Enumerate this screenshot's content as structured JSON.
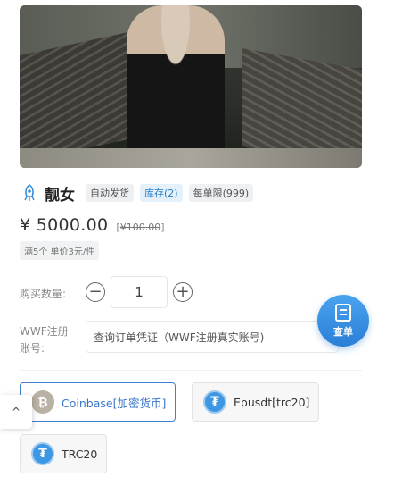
{
  "product": {
    "title": "靓女",
    "tags": [
      "自动发货",
      "库存(2)",
      "每单限(999)"
    ],
    "price": "¥ 5000.00",
    "original_price_bracket_open": "[",
    "original_price": "¥100.00",
    "original_price_bracket_close": "]",
    "promo": "满5个 单价3元/件"
  },
  "quantity": {
    "label": "购买数量:",
    "value": "1",
    "minus_symbol": "−",
    "plus_symbol": "+"
  },
  "account": {
    "label": "WWF注册账号:",
    "placeholder": "查询订单凭证（WWF注册真实账号)"
  },
  "fab": {
    "label": "查单"
  },
  "payment_methods": [
    {
      "label": "Coinbase[加密货币]",
      "icon": "bitcoin-icon",
      "selected": true
    },
    {
      "label": "Epusdt[trc20]",
      "icon": "usdt-icon",
      "selected": false
    },
    {
      "label": "TRC20",
      "icon": "usdt-icon",
      "selected": false
    }
  ],
  "scroll_up_symbol": "^",
  "colors": {
    "accent": "#3f7fd1",
    "stock_tag": "#2d7fc8",
    "fab": "#2a7fd6"
  }
}
